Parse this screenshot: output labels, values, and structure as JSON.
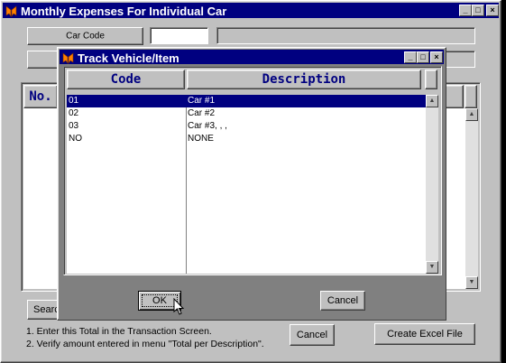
{
  "main_window": {
    "title": "Monthly Expenses For Individual Car",
    "car_code_label": "Car Code",
    "car_code_value": "",
    "grid_col_no": "No.",
    "search_label": "Searc",
    "note_1": "1.  Enter this Total in the Transaction Screen.",
    "note_2": "2.  Verify amount entered in  menu \"Total per Description\".",
    "cancel_label": "Cancel",
    "excel_label": "Create Excel File"
  },
  "dialog": {
    "title": "Track Vehicle/Item",
    "col_code": "Code",
    "col_description": "Description",
    "rows": [
      {
        "code": "01",
        "description": "Car #1"
      },
      {
        "code": "02",
        "description": "Car #2"
      },
      {
        "code": "03",
        "description": "Car #3, , ,"
      },
      {
        "code": "NO",
        "description": "NONE"
      }
    ],
    "selected_index": 0,
    "ok_label": "OK",
    "cancel_label": "Cancel"
  },
  "colors": {
    "titlebar": "#000080",
    "face": "#c0c0c0",
    "dialog_footer": "#808080",
    "header_text": "#000080",
    "icon": "#ff8000"
  },
  "icons": [
    "app-logo-icon",
    "minimize-icon",
    "maximize-icon",
    "close-icon",
    "scroll-up-icon",
    "scroll-down-icon",
    "mouse-cursor-icon"
  ]
}
